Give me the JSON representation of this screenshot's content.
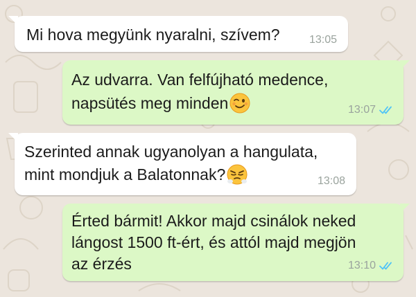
{
  "colors": {
    "incoming_bubble": "#ffffff",
    "outgoing_bubble": "#dcf8c6",
    "read_ticks": "#4fc3f7",
    "timestamp": "#9aa39d",
    "wallpaper": "#ece5dd"
  },
  "messages": [
    {
      "direction": "incoming",
      "lines": [
        "Mi hova megyünk nyaralni, szívem?"
      ],
      "time": "13:05"
    },
    {
      "direction": "outgoing",
      "lines": [
        "Az udvarra. Van felfújható medence,",
        "napsütés meg minden"
      ],
      "emoji": "winking-face-emoji",
      "time": "13:07",
      "status": "read-double-check-icon"
    },
    {
      "direction": "incoming",
      "lines": [
        "Szerinted annak ugyanolyan a hangulata,",
        "mint mondjuk a Balatonnak?"
      ],
      "emoji": "face-with-steam-from-nose-emoji",
      "time": "13:08"
    },
    {
      "direction": "outgoing",
      "lines": [
        "Érted bármit! Akkor majd csinálok neked",
        "lángost 1500 ft-ért, és attól majd megjön",
        "az érzés"
      ],
      "time": "13:10",
      "status": "read-double-check-icon"
    }
  ]
}
